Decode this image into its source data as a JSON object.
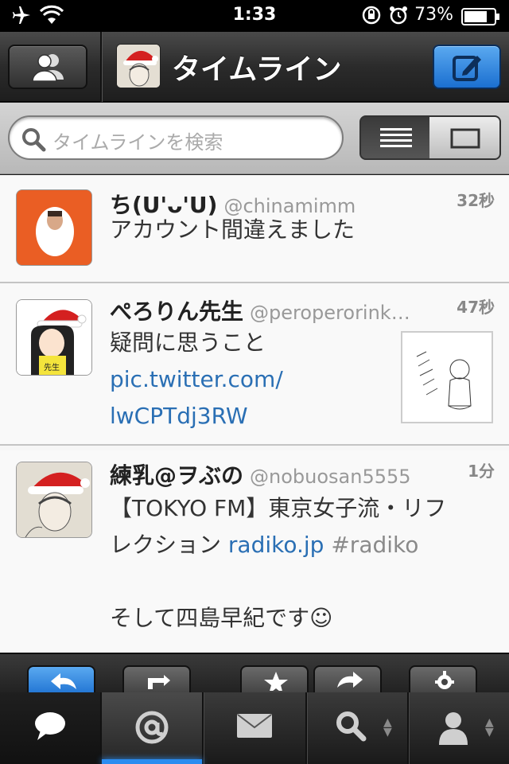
{
  "status_bar": {
    "time": "1:33",
    "battery": "73%"
  },
  "nav": {
    "title": "タイムライン"
  },
  "search": {
    "placeholder": "タイムラインを検索"
  },
  "tweets": [
    {
      "name": "ち(U'ᴗ'U)",
      "handle": "@chinamimm",
      "time": "32秒",
      "text": "アカウント間違えました"
    },
    {
      "name": "ぺろりん先生",
      "handle": "@peroperorink…",
      "time": "47秒",
      "text": "疑問に思うこと",
      "link_line1": "pic.twitter.com/",
      "link_line2": "lwCPTdj3RW"
    },
    {
      "name": "練乳@ヲぶの",
      "handle": "@nobuosan5555",
      "time": "1分",
      "text_line1": "【TOKYO FM】東京女子流・リフ",
      "text_line2_prefix": "レクション ",
      "link": "radiko.jp",
      "hashtag": "#radiko",
      "text_line3": "そして四島早紀です☺"
    }
  ],
  "icons": {
    "airplane": "airplane-icon",
    "wifi": "wifi-icon",
    "lock_rotation": "rotation-lock-icon",
    "alarm": "alarm-icon",
    "battery": "battery-icon",
    "accounts": "accounts-icon",
    "compose": "compose-icon",
    "search": "search-icon",
    "reply": "reply-icon",
    "retweet": "retweet-icon",
    "favorite": "star-icon",
    "share": "share-icon",
    "settings": "gear-icon",
    "tab_timeline": "speech-bubble-icon",
    "tab_mentions": "at-icon",
    "tab_messages": "envelope-icon",
    "tab_search": "magnifier-icon",
    "tab_profile": "person-icon"
  },
  "colors": {
    "accent_blue": "#2b8cf0",
    "link": "#2a6fb4"
  }
}
